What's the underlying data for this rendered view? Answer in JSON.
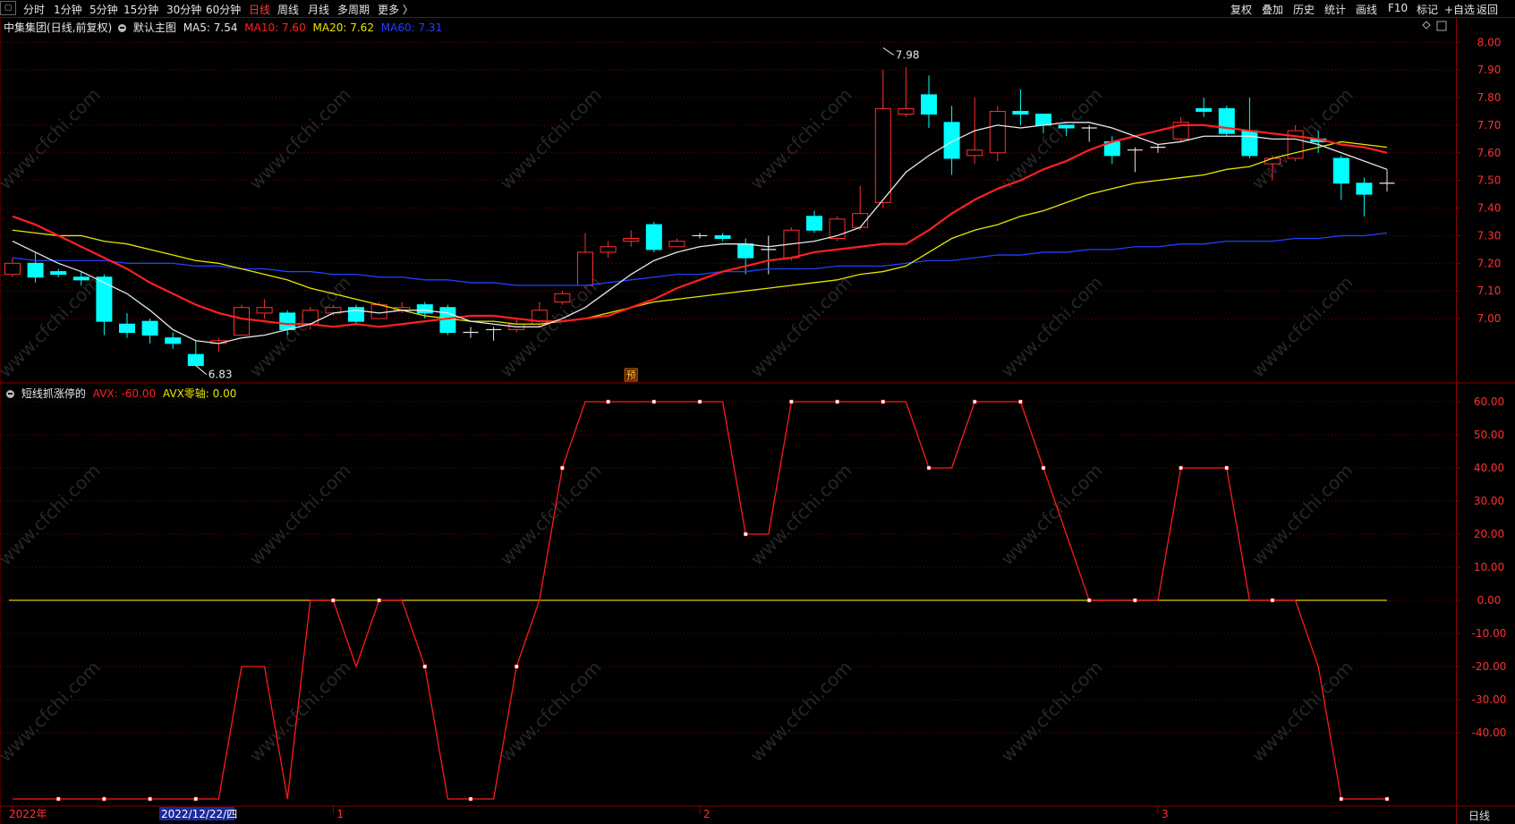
{
  "toolbar": {
    "left": [
      {
        "label": "分时"
      },
      {
        "label": "1分钟"
      },
      {
        "label": "5分钟"
      },
      {
        "label": "15分钟"
      },
      {
        "label": "30分钟"
      },
      {
        "label": "60分钟"
      },
      {
        "label": "日线",
        "active": true
      },
      {
        "label": "周线"
      },
      {
        "label": "月线"
      },
      {
        "label": "多周期"
      },
      {
        "label": "更多 〉"
      }
    ],
    "right": [
      {
        "label": "复权"
      },
      {
        "label": "叠加"
      },
      {
        "label": "历史"
      },
      {
        "label": "统计"
      },
      {
        "label": "画线"
      },
      {
        "label": "F10"
      },
      {
        "label": "标记"
      },
      {
        "label": "+自选"
      },
      {
        "label": "返回"
      }
    ]
  },
  "main_header": {
    "stock": "中集集团(日线,前复权)",
    "template": "默认主图",
    "ma5": "MA5: 7.54",
    "ma10": "MA10: 7.60",
    "ma20": "MA20: 7.62",
    "ma60": "MA60: 7.31"
  },
  "indicator_header": {
    "name": "短线抓涨停的",
    "avx": "AVX: -60.00",
    "zero": "AVX零轴: 0.00"
  },
  "colors": {
    "up": "#ff3030",
    "down": "#00ffff",
    "ma5": "#e8e8e8",
    "ma10": "#ff2020",
    "ma20": "#e6e600",
    "ma60": "#2040ff",
    "avx": "#ff1a1a",
    "zero_line": "#e6c800",
    "grid": "#7a0000",
    "axis_text": "#ff3030"
  },
  "chart_data": [
    {
      "type": "candlestick",
      "name": "price",
      "ylim": [
        6.78,
        8.03
      ],
      "y_ticks": [
        7.0,
        7.1,
        7.2,
        7.3,
        7.4,
        7.5,
        7.6,
        7.7,
        7.8,
        7.9,
        8.0
      ],
      "y_tick_labels": [
        "7.00",
        "7.10",
        "7.20",
        "7.30",
        "7.40",
        "7.50",
        "7.60",
        "7.70",
        "7.80",
        "7.90",
        "8.00"
      ],
      "candles": [
        [
          7.16,
          7.2,
          7.22,
          7.15
        ],
        [
          7.2,
          7.15,
          7.24,
          7.13
        ],
        [
          7.17,
          7.16,
          7.18,
          7.15
        ],
        [
          7.15,
          7.14,
          7.17,
          7.12
        ],
        [
          7.15,
          6.99,
          7.16,
          6.94
        ],
        [
          6.98,
          6.95,
          7.02,
          6.93
        ],
        [
          6.99,
          6.94,
          7.0,
          6.91
        ],
        [
          6.93,
          6.91,
          6.95,
          6.89
        ],
        [
          6.87,
          6.83,
          6.92,
          6.83
        ],
        [
          6.91,
          6.92,
          6.93,
          6.88
        ],
        [
          6.94,
          7.04,
          7.05,
          6.94
        ],
        [
          7.02,
          7.04,
          7.07,
          7.0
        ],
        [
          7.02,
          6.96,
          7.03,
          6.94
        ],
        [
          6.98,
          7.03,
          7.04,
          6.96
        ],
        [
          7.02,
          7.04,
          7.05,
          7.01
        ],
        [
          7.04,
          6.99,
          7.05,
          6.98
        ],
        [
          7.0,
          7.05,
          7.06,
          7.0
        ],
        [
          7.03,
          7.04,
          7.06,
          7.02
        ],
        [
          7.05,
          7.02,
          7.06,
          7.0
        ],
        [
          7.04,
          6.95,
          7.05,
          6.94
        ],
        [
          6.95,
          6.95,
          6.97,
          6.93
        ],
        [
          6.96,
          6.96,
          6.97,
          6.92
        ],
        [
          6.96,
          6.98,
          7.0,
          6.95
        ],
        [
          6.98,
          7.03,
          7.06,
          6.97
        ],
        [
          7.06,
          7.09,
          7.1,
          7.05
        ],
        [
          7.12,
          7.24,
          7.31,
          7.11
        ],
        [
          7.24,
          7.26,
          7.28,
          7.22
        ],
        [
          7.28,
          7.29,
          7.32,
          7.26
        ],
        [
          7.34,
          7.25,
          7.35,
          7.24
        ],
        [
          7.26,
          7.28,
          7.29,
          7.26
        ],
        [
          7.3,
          7.3,
          7.31,
          7.29
        ],
        [
          7.3,
          7.29,
          7.31,
          7.28
        ],
        [
          7.27,
          7.22,
          7.29,
          7.16
        ],
        [
          7.25,
          7.25,
          7.3,
          7.16
        ],
        [
          7.22,
          7.32,
          7.33,
          7.21
        ],
        [
          7.37,
          7.32,
          7.39,
          7.31
        ],
        [
          7.29,
          7.36,
          7.37,
          7.28
        ],
        [
          7.33,
          7.38,
          7.48,
          7.32
        ],
        [
          7.42,
          7.76,
          7.9,
          7.4
        ],
        [
          7.74,
          7.76,
          7.91,
          7.73
        ],
        [
          7.81,
          7.74,
          7.88,
          7.69
        ],
        [
          7.71,
          7.58,
          7.77,
          7.52
        ],
        [
          7.59,
          7.61,
          7.8,
          7.56
        ],
        [
          7.6,
          7.75,
          7.77,
          7.57
        ],
        [
          7.75,
          7.74,
          7.83,
          7.7
        ],
        [
          7.74,
          7.7,
          7.74,
          7.67
        ],
        [
          7.7,
          7.69,
          7.7,
          7.66
        ],
        [
          7.69,
          7.69,
          7.7,
          7.64
        ],
        [
          7.64,
          7.59,
          7.66,
          7.56
        ],
        [
          7.61,
          7.61,
          7.62,
          7.53
        ],
        [
          7.62,
          7.62,
          7.63,
          7.6
        ],
        [
          7.65,
          7.71,
          7.73,
          7.64
        ],
        [
          7.76,
          7.75,
          7.8,
          7.73
        ],
        [
          7.76,
          7.67,
          7.77,
          7.66
        ],
        [
          7.68,
          7.59,
          7.8,
          7.58
        ],
        [
          7.56,
          7.58,
          7.59,
          7.5
        ],
        [
          7.58,
          7.68,
          7.7,
          7.57
        ],
        [
          7.65,
          7.64,
          7.68,
          7.6
        ],
        [
          7.58,
          7.49,
          7.59,
          7.43
        ],
        [
          7.49,
          7.45,
          7.51,
          7.37
        ],
        [
          7.49,
          7.49,
          7.54,
          7.46
        ]
      ],
      "ma5": [
        7.28,
        7.24,
        7.2,
        7.17,
        7.13,
        7.09,
        7.03,
        6.96,
        6.92,
        6.91,
        6.93,
        6.94,
        6.96,
        6.98,
        7.02,
        7.03,
        7.02,
        7.03,
        7.03,
        7.02,
        6.99,
        6.98,
        6.97,
        6.97,
        7.0,
        7.04,
        7.1,
        7.16,
        7.21,
        7.24,
        7.26,
        7.27,
        7.27,
        7.26,
        7.27,
        7.28,
        7.3,
        7.33,
        7.43,
        7.53,
        7.59,
        7.64,
        7.68,
        7.7,
        7.69,
        7.7,
        7.71,
        7.71,
        7.69,
        7.66,
        7.63,
        7.64,
        7.66,
        7.66,
        7.66,
        7.65,
        7.65,
        7.63,
        7.6,
        7.57,
        7.54
      ],
      "ma10": [
        7.37,
        7.34,
        7.3,
        7.26,
        7.22,
        7.18,
        7.13,
        7.09,
        7.05,
        7.02,
        7.0,
        6.99,
        6.98,
        6.98,
        6.97,
        6.98,
        6.97,
        6.98,
        6.99,
        7.0,
        7.01,
        7.01,
        7.0,
        6.99,
        6.99,
        7.0,
        7.01,
        7.04,
        7.07,
        7.11,
        7.14,
        7.17,
        7.19,
        7.21,
        7.22,
        7.24,
        7.25,
        7.26,
        7.27,
        7.27,
        7.32,
        7.38,
        7.43,
        7.47,
        7.5,
        7.54,
        7.57,
        7.61,
        7.64,
        7.66,
        7.68,
        7.7,
        7.7,
        7.69,
        7.68,
        7.67,
        7.66,
        7.65,
        7.63,
        7.62,
        7.6
      ],
      "ma20": [
        7.32,
        7.31,
        7.3,
        7.3,
        7.28,
        7.27,
        7.25,
        7.23,
        7.21,
        7.2,
        7.18,
        7.16,
        7.14,
        7.11,
        7.09,
        7.07,
        7.05,
        7.03,
        7.01,
        7.0,
        6.99,
        6.99,
        6.98,
        6.98,
        6.99,
        7.0,
        7.02,
        7.04,
        7.06,
        7.07,
        7.08,
        7.09,
        7.1,
        7.11,
        7.12,
        7.13,
        7.14,
        7.16,
        7.17,
        7.19,
        7.24,
        7.29,
        7.32,
        7.34,
        7.37,
        7.39,
        7.42,
        7.45,
        7.47,
        7.49,
        7.5,
        7.51,
        7.52,
        7.54,
        7.55,
        7.58,
        7.6,
        7.62,
        7.64,
        7.63,
        7.62
      ],
      "ma60": [
        7.22,
        7.21,
        7.21,
        7.21,
        7.21,
        7.2,
        7.2,
        7.2,
        7.19,
        7.19,
        7.18,
        7.18,
        7.17,
        7.17,
        7.16,
        7.16,
        7.15,
        7.15,
        7.14,
        7.14,
        7.13,
        7.13,
        7.12,
        7.12,
        7.12,
        7.12,
        7.13,
        7.14,
        7.15,
        7.16,
        7.16,
        7.17,
        7.17,
        7.18,
        7.18,
        7.18,
        7.19,
        7.19,
        7.19,
        7.2,
        7.21,
        7.21,
        7.22,
        7.23,
        7.23,
        7.24,
        7.24,
        7.25,
        7.25,
        7.26,
        7.26,
        7.27,
        7.27,
        7.28,
        7.28,
        7.28,
        7.29,
        7.29,
        7.3,
        7.3,
        7.31
      ],
      "annotations": [
        {
          "label": "7.98",
          "index": 38,
          "value": 7.98
        },
        {
          "label": "6.83",
          "index": 8,
          "value": 6.83
        }
      ],
      "pre_marker": {
        "label": "预",
        "index": 27
      }
    },
    {
      "type": "line",
      "name": "AVX",
      "ylim": [
        -60,
        60
      ],
      "y_ticks": [
        60,
        50,
        40,
        30,
        20,
        10,
        0,
        -10,
        -20,
        -30,
        -40
      ],
      "y_tick_labels": [
        "60.00",
        "50.00",
        "40.00",
        "30.00",
        "20.00",
        "10.00",
        "0.00",
        "-10.00",
        "-20.00",
        "-30.00",
        "-40.00"
      ],
      "values": [
        -60,
        -60,
        -60,
        -60,
        -60,
        -60,
        -60,
        -60,
        -60,
        -60,
        -20,
        -20,
        -60,
        0,
        0,
        -20,
        0,
        0,
        -20,
        -60,
        -60,
        -60,
        -20,
        0,
        40,
        60,
        60,
        60,
        60,
        60,
        60,
        60,
        20,
        20,
        60,
        60,
        60,
        60,
        60,
        60,
        40,
        40,
        60,
        60,
        60,
        40,
        20,
        0,
        0,
        0,
        0,
        40,
        40,
        40,
        0,
        0,
        0,
        -20,
        -60,
        -60,
        -60
      ],
      "markers": [
        2,
        4,
        6,
        8,
        14,
        16,
        18,
        20,
        22,
        24,
        26,
        28,
        30,
        32,
        34,
        36,
        38,
        40,
        42,
        44,
        45,
        47,
        49,
        51,
        53,
        55,
        58,
        60
      ],
      "zero_line": 0
    }
  ],
  "x_axis": {
    "labels": [
      {
        "text": "2022年",
        "index": 0
      },
      {
        "text": "2022/12/22/四",
        "index": 7,
        "highlight": true
      },
      {
        "text": "1",
        "index": 14
      },
      {
        "text": "2",
        "index": 30
      },
      {
        "text": "3",
        "index": 50
      }
    ],
    "period": "日线"
  },
  "watermark": "www.cfchi.com"
}
